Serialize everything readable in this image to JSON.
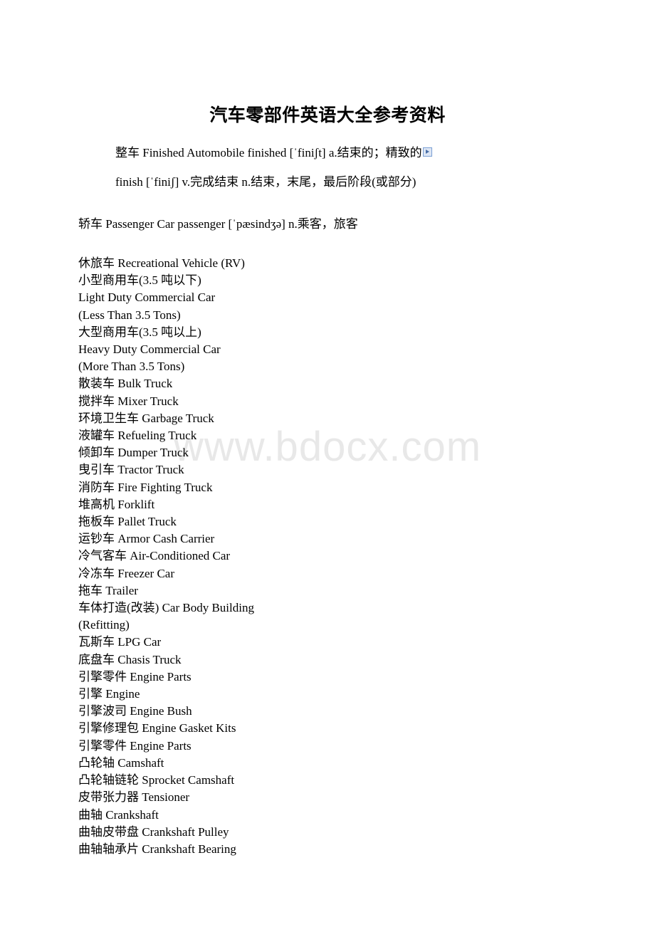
{
  "document": {
    "title": "汽车零部件英语大全参考资料",
    "watermark": "www.bdocx.com"
  },
  "intro": {
    "line1": "整车 Finished Automobile finished  [ˈfiniʃt] a.结束的；精致的",
    "line2": "finish  [ˈfiniʃ] v.完成结束 n.结束，末尾，最后阶段(或部分)",
    "line3": "轿车 Passenger Car passenger  [ˈpæsindʒə] n.乘客，旅客",
    "marker_icon": "expand-marker-icon"
  },
  "vocabulary": {
    "lines": [
      "休旅车 Recreational Vehicle (RV)",
      "小型商用车(3.5 吨以下)",
      "Light Duty Commercial Car",
      "(Less Than 3.5 Tons)",
      "大型商用车(3.5 吨以上)",
      "Heavy Duty Commercial Car",
      "(More Than 3.5 Tons)",
      "散装车 Bulk Truck",
      "搅拌车 Mixer Truck",
      "环境卫生车 Garbage Truck",
      "液罐车 Refueling Truck",
      "倾卸车 Dumper Truck",
      "曳引车 Tractor Truck",
      "消防车 Fire Fighting Truck",
      "堆高机 Forklift",
      "拖板车 Pallet Truck",
      "运钞车 Armor Cash Carrier",
      "冷气客车 Air-Conditioned Car",
      "冷冻车 Freezer Car",
      "拖车 Trailer",
      "车体打造(改装) Car Body Building",
      "(Refitting)",
      "瓦斯车 LPG Car",
      "底盘车 Chasis Truck",
      "引擎零件 Engine Parts",
      "引擎 Engine",
      "引擎波司 Engine Bush",
      "引擎修理包 Engine Gasket Kits",
      "引擎零件 Engine Parts",
      "凸轮轴 Camshaft",
      "凸轮轴链轮 Sprocket Camshaft",
      "皮带张力器 Tensioner",
      "曲轴 Crankshaft",
      "曲轴皮带盘 Crankshaft Pulley",
      "曲轴轴承片 Crankshaft Bearing"
    ]
  },
  "colors": {
    "text": "#000000",
    "watermark": "#e8e8e8",
    "marker_border": "#7a9fd4",
    "marker_fill": "#dde6f4"
  }
}
